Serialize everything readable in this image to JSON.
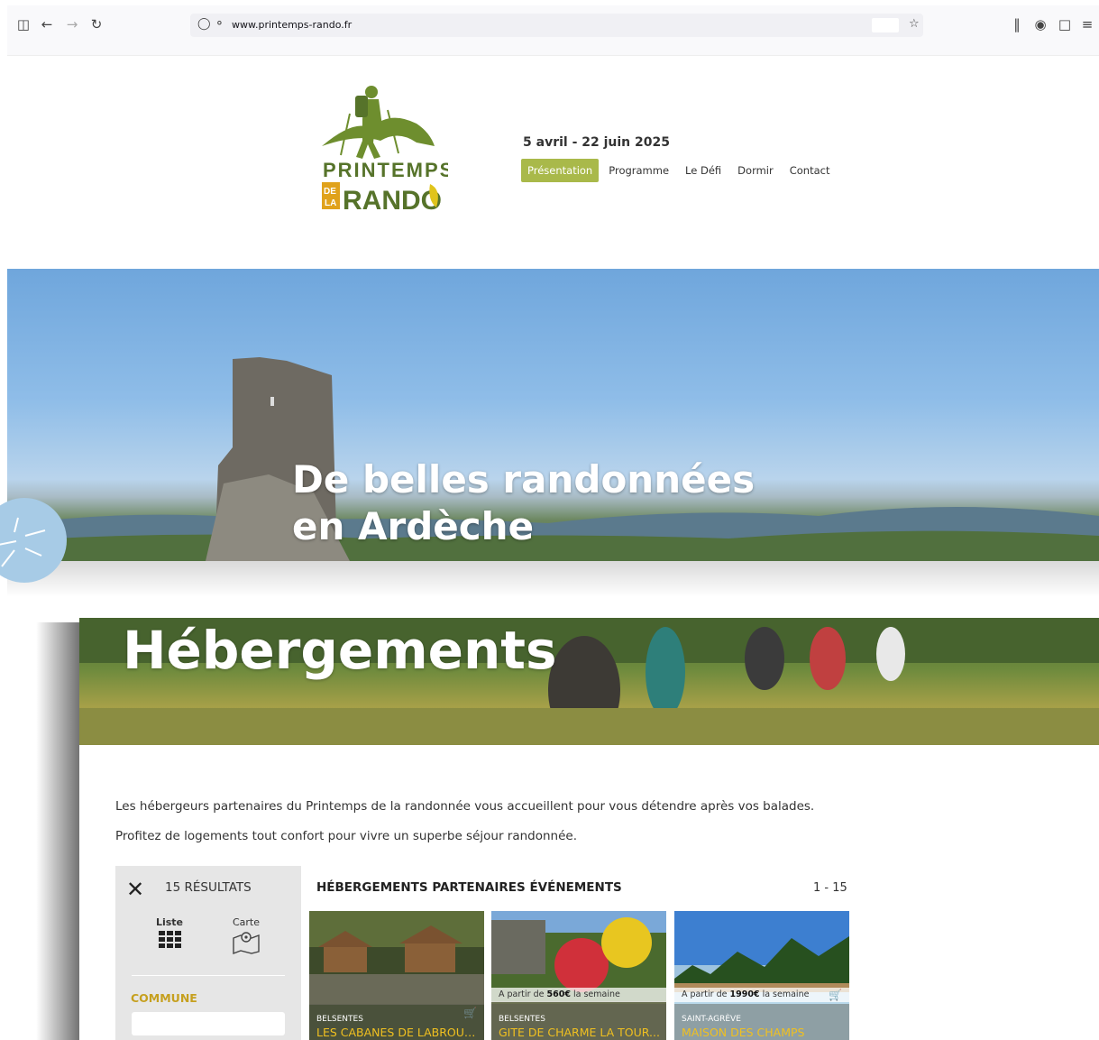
{
  "browser": {
    "url": "www.printemps-rando.fr",
    "icons": [
      "sidebar-icon",
      "back-icon",
      "forward-icon",
      "reload-icon",
      "shield-icon",
      "lock-icon",
      "star-icon",
      "library-icon",
      "account-icon",
      "extensions-icon",
      "menu-icon"
    ]
  },
  "header": {
    "logo_text_line1": "PRINTEMPS",
    "logo_text_de": "DE",
    "logo_text_la": "LA",
    "logo_text_line2": "RANDO",
    "date": "5 avril - 22 juin 2025",
    "menu": [
      {
        "label": "Présentation",
        "active": true
      },
      {
        "label": "Programme",
        "active": false
      },
      {
        "label": "Le Défi",
        "active": false
      },
      {
        "label": "Dormir",
        "active": false
      },
      {
        "label": "Contact",
        "active": false
      }
    ]
  },
  "hero": {
    "title_line1": "De belles randonnées",
    "title_line2": "en Ardèche"
  },
  "hebergements": {
    "banner_title": "Hébergements",
    "intro1": "Les hébergeurs partenaires du Printemps de la randonnée vous accueillent pour vous détendre après vos balades.",
    "intro2": "Profitez de logements tout confort pour vivre un superbe séjour randonnée."
  },
  "filter": {
    "results": "15 RÉSULTATS",
    "view_list": "Liste",
    "view_map": "Carte",
    "commune_label": "COMMUNE",
    "commune_value": ""
  },
  "listing": {
    "title": "HÉBERGEMENTS PARTENAIRES ÉVÉNEMENTS",
    "pager": "1 - 15",
    "cards": [
      {
        "city": "BELSENTES",
        "name": "LES CABANES DE LABROUS...",
        "price_prefix": "",
        "price": "",
        "price_suffix": ""
      },
      {
        "city": "BELSENTES",
        "name": "GITE DE CHARME LA TOUR...",
        "price_prefix": "A partir de",
        "price": "560€",
        "price_suffix": "la semaine"
      },
      {
        "city": "SAINT-AGRÈVE",
        "name": "MAISON DES CHAMPS",
        "price_prefix": "A partir de",
        "price": "1990€",
        "price_suffix": "la semaine"
      }
    ]
  },
  "colors": {
    "accent_green": "#a9b94a",
    "commune_gold": "#c6a01f",
    "card_name_yellow": "#f0c020"
  }
}
